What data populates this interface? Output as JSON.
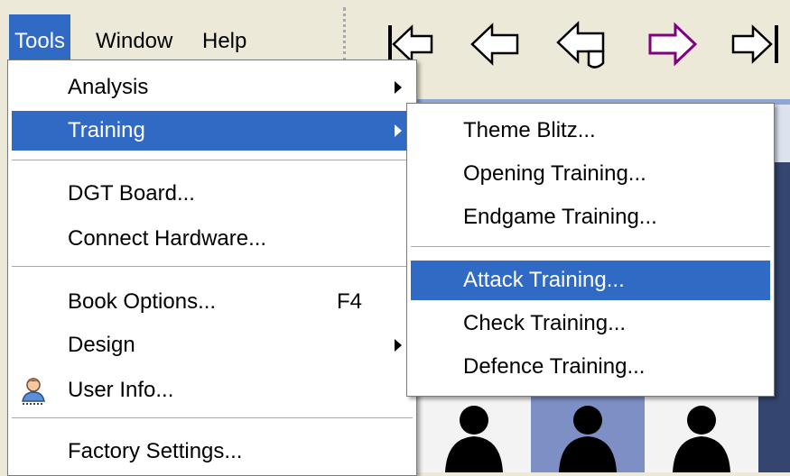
{
  "menubar": {
    "items": [
      {
        "label": "Tools",
        "active": true
      },
      {
        "label": "Window",
        "active": false
      },
      {
        "label": "Help",
        "active": false
      }
    ]
  },
  "toolbar": {
    "buttons": [
      {
        "icon": "skip-to-start-icon"
      },
      {
        "icon": "back-arrow-icon"
      },
      {
        "icon": "take-back-arrow-icon"
      },
      {
        "icon": "forward-arrow-icon",
        "color": "#800080"
      },
      {
        "icon": "skip-to-end-icon"
      }
    ]
  },
  "tools_menu": {
    "items": [
      {
        "label": "Analysis",
        "submenu": true
      },
      {
        "label": "Training",
        "submenu": true,
        "highlighted": true
      },
      {
        "label": "DGT Board..."
      },
      {
        "label": "Connect Hardware..."
      },
      {
        "label": "Book Options...",
        "shortcut": "F4"
      },
      {
        "label": "Design",
        "submenu": true
      },
      {
        "label": "User Info...",
        "icon": "user-icon"
      },
      {
        "label": "Factory Settings..."
      }
    ]
  },
  "training_submenu": {
    "items": [
      {
        "label": "Theme Blitz..."
      },
      {
        "label": "Opening Training..."
      },
      {
        "label": "Endgame Training..."
      },
      {
        "label": "Attack Training...",
        "highlighted": true
      },
      {
        "label": "Check Training..."
      },
      {
        "label": "Defence Training..."
      }
    ]
  },
  "colors": {
    "highlight": "#316ac5",
    "menu_background": "#ffffff",
    "chrome": "#ece9d8"
  }
}
